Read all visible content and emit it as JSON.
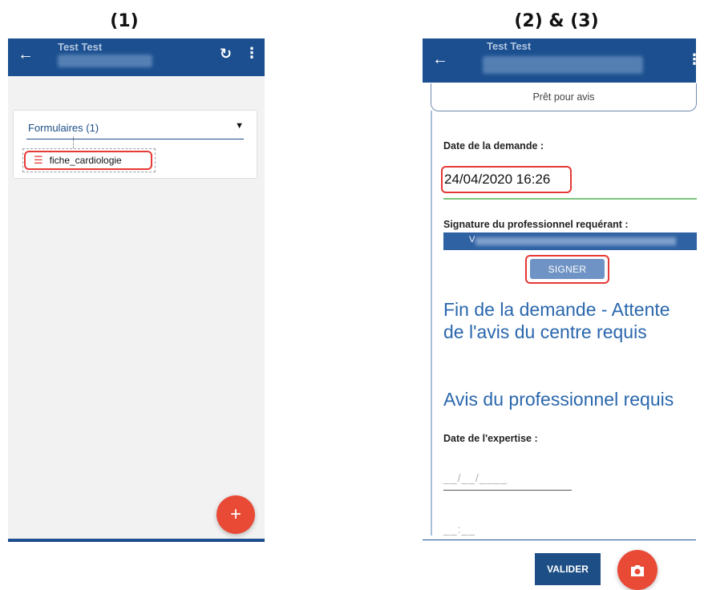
{
  "captions": {
    "left": "(1)",
    "right": "(2) & (3)"
  },
  "panel1": {
    "appbar": {
      "title_ghost": "Test Test"
    },
    "card": {
      "title": "Formulaires (1)"
    },
    "form_item": {
      "label": "fiche_cardiologie"
    },
    "fab_label": "+"
  },
  "panel2": {
    "appbar": {
      "title_ghost": "Test Test"
    },
    "status": "Prêt pour avis",
    "date_demande_label": "Date de la demande :",
    "date_demande_value": "24/04/2020 16:26",
    "signature_label": "Signature du professionnel requérant :",
    "signature_initial": "V",
    "signer_label": "SIGNER",
    "heading_fin_line1": "Fin de la demande - Attente",
    "heading_fin_line2": "de l'avis du centre requis",
    "heading_avis": "Avis du professionnel requis",
    "date_expertise_label": "Date de l'expertise :",
    "date_mask": "__/__/____",
    "time_mask": "__:__",
    "valider_label": "VALIDER"
  },
  "colors": {
    "primary": "#1b4f8f",
    "accent": "#e84a36",
    "highlight": "#e53935"
  }
}
